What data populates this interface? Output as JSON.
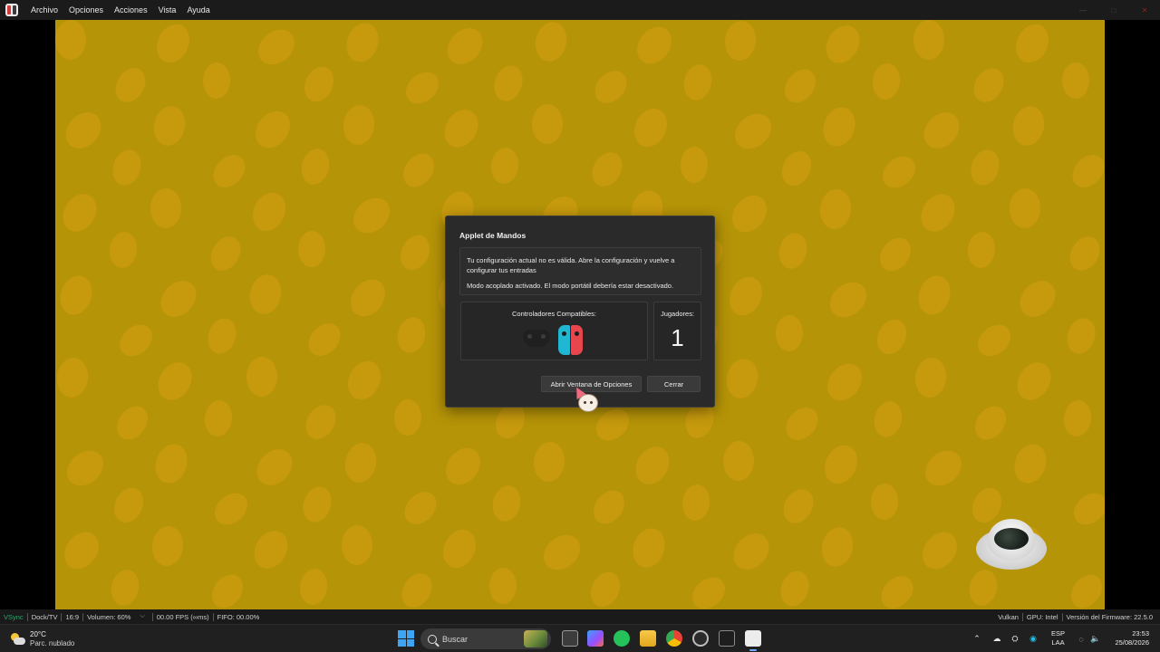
{
  "menubar": {
    "items": [
      "Archivo",
      "Opciones",
      "Acciones",
      "Vista",
      "Ayuda"
    ]
  },
  "dialog": {
    "title": "Applet de Mandos",
    "message_1": "Tu configuración actual no es válida. Abre la configuración y vuelve a configurar tus entradas",
    "message_2": "Modo acoplado activado. El modo portátil debería estar desactivado.",
    "controllers_label": "Controladores Compatibles:",
    "controllers_icons": [
      "pro-controller-icon",
      "joycon-left-icon",
      "joycon-right-icon"
    ],
    "players_label": "Jugadores:",
    "players_count": "1",
    "open_options_label": "Abrir Ventana de Opciones",
    "close_label": "Cerrar"
  },
  "statusbar": {
    "vsync": "VSync",
    "dock_mode": "Dock/TV",
    "aspect": "16:9",
    "volume": "Volumen: 60%",
    "fps": "00.00 FPS (∞ms)",
    "fifo": "FIFO: 00.00%",
    "backend": "Vulkan",
    "gpu": "GPU: Intel",
    "firmware": "Versión del Firmware: 22.5.0"
  },
  "taskbar": {
    "weather_temp": "20°C",
    "weather_desc": "Parc. nublado",
    "search_placeholder": "Buscar",
    "lang_primary": "ESP",
    "lang_secondary": "LAA",
    "time": "23:53",
    "date": "25/08/2026"
  },
  "colors": {
    "game_background": "#b69407",
    "game_blob": "#c89a0e",
    "dialog_bg": "#2a2a2a",
    "vsync_green": "#2ca66e",
    "joycon_blue": "#1fb7d1",
    "joycon_red": "#e8464d"
  }
}
